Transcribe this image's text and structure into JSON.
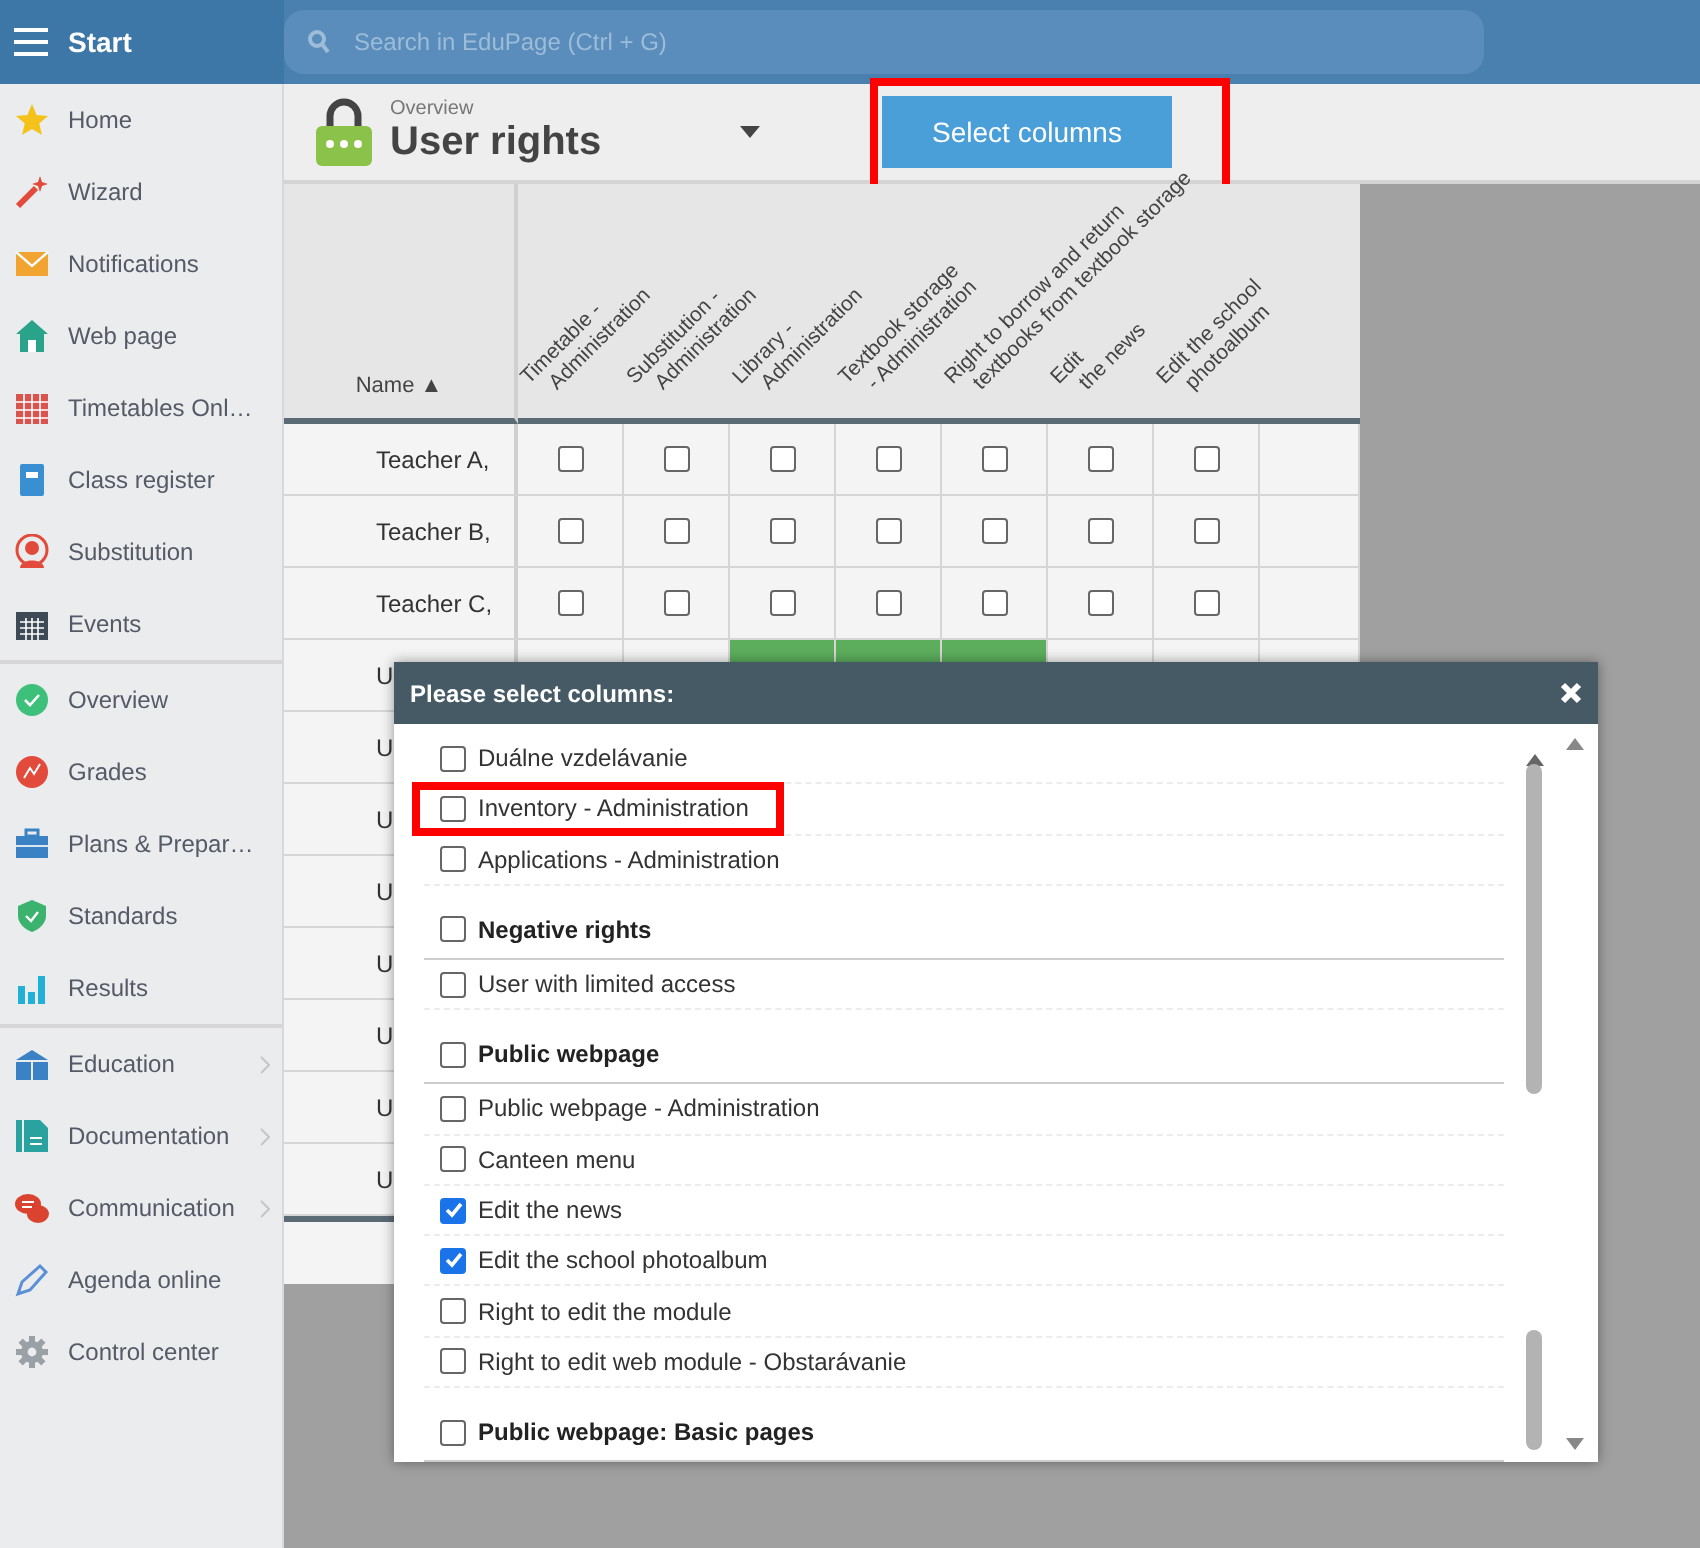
{
  "topbar": {
    "title": "Start",
    "search": {
      "placeholder": "Search in EduPage (Ctrl + G)"
    }
  },
  "sidebar": {
    "groups": [
      {
        "items": [
          {
            "label": "Home",
            "expandable": false
          },
          {
            "label": "Wizard",
            "expandable": false
          },
          {
            "label": "Notifications",
            "expandable": false
          },
          {
            "label": "Web page",
            "expandable": false
          },
          {
            "label": "Timetables Onl…",
            "expandable": false
          },
          {
            "label": "Class register",
            "expandable": false
          },
          {
            "label": "Substitution",
            "expandable": false
          },
          {
            "label": "Events",
            "expandable": false
          }
        ]
      },
      {
        "items": [
          {
            "label": "Overview",
            "expandable": false
          },
          {
            "label": "Grades",
            "expandable": false
          },
          {
            "label": "Plans & Prepar…",
            "expandable": false
          },
          {
            "label": "Standards",
            "expandable": false
          },
          {
            "label": "Results",
            "expandable": false
          }
        ]
      },
      {
        "items": [
          {
            "label": "Education",
            "expandable": true
          },
          {
            "label": "Documentation",
            "expandable": true
          },
          {
            "label": "Communication",
            "expandable": true
          },
          {
            "label": "Agenda online",
            "expandable": false
          },
          {
            "label": "Control center",
            "expandable": false
          }
        ]
      }
    ]
  },
  "header": {
    "breadcrumb": "Overview",
    "title": "User rights",
    "button": {
      "label": "Select columns",
      "highlighted": true
    }
  },
  "table": {
    "name_column": "Name ▲",
    "columns": [
      {
        "line_1": "Timetable -",
        "line_2": "Administration"
      },
      {
        "line_1": "Substitution -",
        "line_2": "Administration"
      },
      {
        "line_1": "Library -",
        "line_2": "Administration"
      },
      {
        "line_1": "Textbook storage",
        "line_2": "- Administration"
      },
      {
        "line_1": "Right to borrow and return",
        "line_2": "textbooks from textbook storage"
      },
      {
        "line_1": "Edit",
        "line_2": "the news"
      },
      {
        "line_1": "Edit the school",
        "line_2": "photoalbum"
      }
    ],
    "rows": [
      {
        "name": "Teacher A,",
        "cells": [
          {
            "checked": false,
            "granted": false
          },
          {
            "checked": false,
            "granted": false
          },
          {
            "checked": false,
            "granted": false
          },
          {
            "checked": false,
            "granted": false
          },
          {
            "checked": false,
            "granted": false
          },
          {
            "checked": false,
            "granted": false
          },
          {
            "checked": false,
            "granted": false
          }
        ]
      },
      {
        "name": "Teacher B,",
        "cells": [
          {
            "checked": false,
            "granted": false
          },
          {
            "checked": false,
            "granted": false
          },
          {
            "checked": false,
            "granted": false
          },
          {
            "checked": false,
            "granted": false
          },
          {
            "checked": false,
            "granted": false
          },
          {
            "checked": false,
            "granted": false
          },
          {
            "checked": false,
            "granted": false
          }
        ]
      },
      {
        "name": "Teacher C,",
        "cells": [
          {
            "checked": false,
            "granted": false
          },
          {
            "checked": false,
            "granted": false
          },
          {
            "checked": false,
            "granted": false
          },
          {
            "checked": false,
            "granted": false
          },
          {
            "checked": false,
            "granted": false
          },
          {
            "checked": false,
            "granted": false
          },
          {
            "checked": false,
            "granted": false
          }
        ]
      },
      {
        "name": "U",
        "cells": [
          {
            "granted": false
          },
          {
            "granted": false
          },
          {
            "granted": true
          },
          {
            "granted": true
          },
          {
            "granted": true
          },
          {
            "granted": false
          },
          {
            "granted": false
          }
        ]
      },
      {
        "name": "U",
        "cells": []
      },
      {
        "name": "U",
        "cells": []
      },
      {
        "name": "U",
        "cells": []
      },
      {
        "name": "U",
        "cells": []
      },
      {
        "name": "U",
        "cells": []
      },
      {
        "name": "U",
        "cells": []
      },
      {
        "name": "U",
        "cells": []
      }
    ]
  },
  "dialog": {
    "title": "Please select columns:",
    "items": [
      {
        "kind": "option",
        "label": "Duálne vzdelávanie",
        "checked": false,
        "highlighted": false
      },
      {
        "kind": "option",
        "label": "Inventory - Administration",
        "checked": false,
        "highlighted": true
      },
      {
        "kind": "option",
        "label": "Applications - Administration",
        "checked": false,
        "highlighted": false
      },
      {
        "kind": "group",
        "label": "Negative rights",
        "checked": false,
        "highlighted": false
      },
      {
        "kind": "option",
        "label": "User with limited access",
        "checked": false,
        "highlighted": false
      },
      {
        "kind": "group",
        "label": "Public webpage",
        "checked": false,
        "highlighted": false
      },
      {
        "kind": "option",
        "label": "Public webpage - Administration",
        "checked": false,
        "highlighted": false
      },
      {
        "kind": "option",
        "label": "Canteen menu",
        "checked": false,
        "highlighted": false
      },
      {
        "kind": "option",
        "label": "Edit the news",
        "checked": true,
        "highlighted": false
      },
      {
        "kind": "option",
        "label": "Edit the school photoalbum",
        "checked": true,
        "highlighted": false
      },
      {
        "kind": "option",
        "label": "Right to edit the module",
        "checked": false,
        "highlighted": false
      },
      {
        "kind": "option",
        "label": "Right to edit web module - Obstarávanie",
        "checked": false,
        "highlighted": false
      },
      {
        "kind": "group",
        "label": "Public webpage: Basic pages",
        "checked": false,
        "highlighted": false
      }
    ]
  }
}
